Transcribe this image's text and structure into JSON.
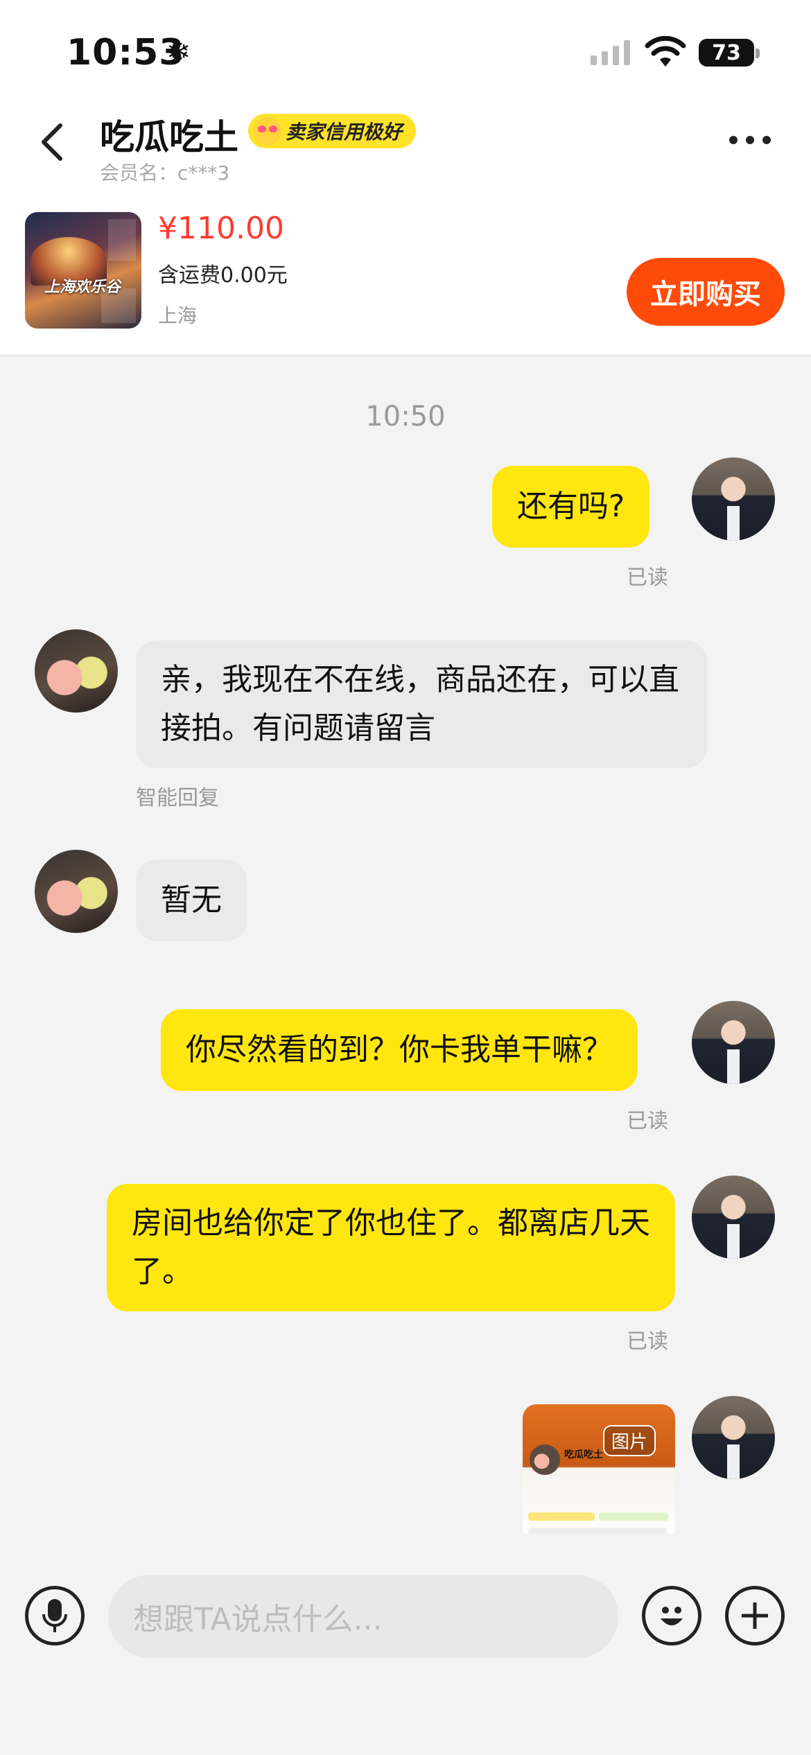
{
  "status_bar": {
    "time": "10:53",
    "battery": "73"
  },
  "header": {
    "title": "吃瓜吃土",
    "badge": "卖家信用极好",
    "member_line": "会员名：c***3"
  },
  "product": {
    "thumbnail_label": "上海欢乐谷",
    "price": "¥110.00",
    "shipping": "含运费0.00元",
    "location": "上海",
    "buy_button": "立即购买"
  },
  "chat": {
    "time_separator": "10:50",
    "messages": [
      {
        "side": "mine",
        "text": "还有吗?",
        "status": "已读"
      },
      {
        "side": "theirs",
        "text": "亲，我现在不在线，商品还在，可以直接拍。有问题请留言",
        "note": "智能回复"
      },
      {
        "side": "theirs",
        "text": "暂无"
      },
      {
        "side": "mine",
        "text": "你尽然看的到？你卡我单干嘛？",
        "status": "已读"
      },
      {
        "side": "mine",
        "text": "房间也给你定了你也住了。都离店几天了。",
        "status": "已读"
      },
      {
        "side": "mine",
        "type": "image",
        "image_tag": "图片",
        "image_title": "吃瓜吃土"
      }
    ]
  },
  "input": {
    "placeholder": "想跟TA说点什么..."
  },
  "icons": {
    "back": "chevron-left-icon",
    "more": "more-dots-icon",
    "mic": "microphone-icon",
    "emoji": "emoji-icon",
    "plus": "plus-icon"
  },
  "colors": {
    "accent_yellow": "#ffe60f",
    "buy_orange": "#ff4b0a",
    "price_red": "#ff3b30"
  }
}
